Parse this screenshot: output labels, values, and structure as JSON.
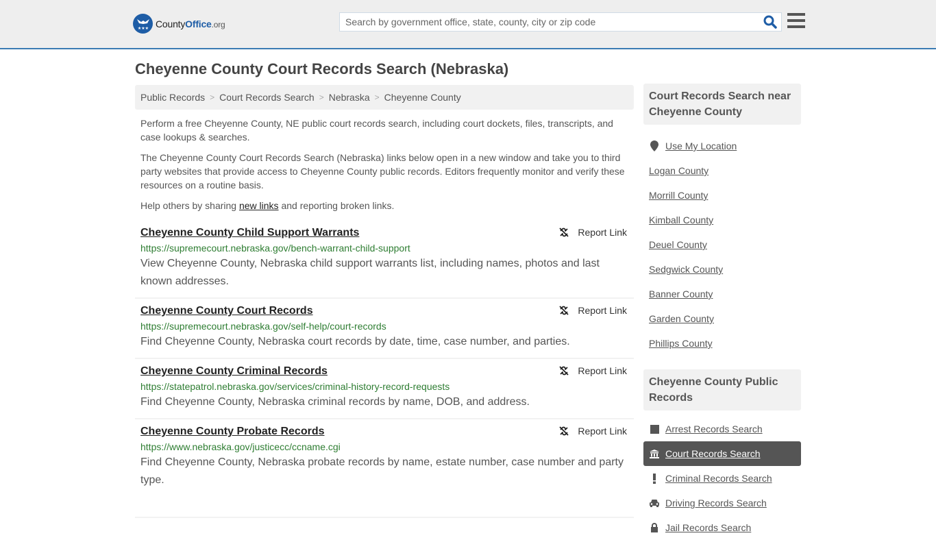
{
  "header": {
    "logo": {
      "county": "County",
      "office": "Office",
      "org": ".org"
    },
    "search_placeholder": "Search by government office, state, county, city or zip code",
    "search_icon": "search-icon",
    "menu_icon": "hamburger-menu-icon"
  },
  "page_title": "Cheyenne County Court Records Search (Nebraska)",
  "breadcrumb": [
    {
      "label": "Public Records"
    },
    {
      "label": "Court Records Search"
    },
    {
      "label": "Nebraska"
    },
    {
      "label": "Cheyenne County"
    }
  ],
  "intro": {
    "p1": "Perform a free Cheyenne County, NE public court records search, including court dockets, files, transcripts, and case lookups & searches.",
    "p2": "The Cheyenne County Court Records Search (Nebraska) links below open in a new window and take you to third party websites that provide access to Cheyenne County public records. Editors frequently monitor and verify these resources on a routine basis.",
    "p3_before": "Help others by sharing ",
    "p3_link": "new links",
    "p3_after": " and reporting broken links."
  },
  "report_label": "Report Link",
  "results": [
    {
      "title": "Cheyenne County Child Support Warrants",
      "url": "https://supremecourt.nebraska.gov/bench-warrant-child-support",
      "desc": "View Cheyenne County, Nebraska child support warrants list, including names, photos and last known addresses."
    },
    {
      "title": "Cheyenne County Court Records",
      "url": "https://supremecourt.nebraska.gov/self-help/court-records",
      "desc": "Find Cheyenne County, Nebraska court records by date, time, case number, and parties."
    },
    {
      "title": "Cheyenne County Criminal Records",
      "url": "https://statepatrol.nebraska.gov/services/criminal-history-record-requests",
      "desc": "Find Cheyenne County, Nebraska criminal records by name, DOB, and address."
    },
    {
      "title": "Cheyenne County Probate Records",
      "url": "https://www.nebraska.gov/justicecc/ccname.cgi",
      "desc": "Find Cheyenne County, Nebraska probate records by name, estate number, case number and party type."
    }
  ],
  "sidebar": {
    "nearby": {
      "heading": "Court Records Search near Cheyenne County",
      "use_location": "Use My Location",
      "counties": [
        "Logan County",
        "Morrill County",
        "Kimball County",
        "Deuel County",
        "Sedgwick County",
        "Banner County",
        "Garden County",
        "Phillips County"
      ]
    },
    "public_records": {
      "heading": "Cheyenne County Public Records",
      "items": [
        {
          "label": "Arrest Records Search",
          "icon": "square-icon",
          "active": false
        },
        {
          "label": "Court Records Search",
          "icon": "courthouse-icon",
          "active": true
        },
        {
          "label": "Criminal Records Search",
          "icon": "exclamation-icon",
          "active": false
        },
        {
          "label": "Driving Records Search",
          "icon": "car-icon",
          "active": false
        },
        {
          "label": "Jail Records Search",
          "icon": "lock-icon",
          "active": false
        }
      ]
    }
  },
  "colors": {
    "brand_blue": "#1e5da6",
    "header_border": "#3b7bb3",
    "url_green": "#2e7d32",
    "active_bg": "#555555"
  }
}
